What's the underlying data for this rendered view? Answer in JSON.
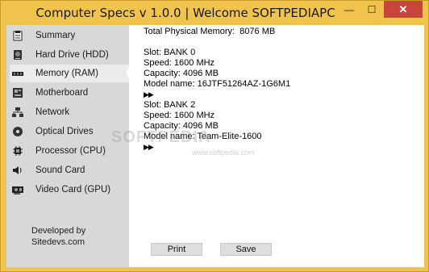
{
  "window": {
    "title": "Computer Specs v 1.0.0  |  Welcome SOFTPEDIAPC",
    "minimize_symbol": "—",
    "maximize_symbol": "☐",
    "close_symbol": "✕"
  },
  "sidebar": {
    "items": [
      {
        "label": "Summary",
        "icon": "clipboard-icon"
      },
      {
        "label": "Hard Drive (HDD)",
        "icon": "hard-drive-icon"
      },
      {
        "label": "Memory (RAM)",
        "icon": "memory-icon",
        "active": true
      },
      {
        "label": "Motherboard",
        "icon": "motherboard-icon"
      },
      {
        "label": "Network",
        "icon": "network-icon"
      },
      {
        "label": "Optical Drives",
        "icon": "disc-icon"
      },
      {
        "label": "Processor (CPU)",
        "icon": "processor-icon"
      },
      {
        "label": "Sound Card",
        "icon": "speaker-icon"
      },
      {
        "label": "Video Card (GPU)",
        "icon": "video-card-icon"
      }
    ],
    "developer_line1": "Developed by",
    "developer_line2": "Sitedevs.com"
  },
  "content": {
    "total_memory": "Total Physical Memory:  8076 MB",
    "marker": "▶▶",
    "slots": [
      {
        "slot": "Slot: BANK 0",
        "speed": "Speed: 1600 MHz",
        "capacity": "Capacity: 4096 MB",
        "model": "Model name: 16JTF51264AZ-1G6M1"
      },
      {
        "slot": "Slot: BANK 2",
        "speed": "Speed: 1600 MHz",
        "capacity": "Capacity: 4096 MB",
        "model": "Model name: Team-Elite-1600"
      }
    ]
  },
  "watermark": {
    "text": "SOFTPEDIA",
    "sub": "www.softpedia.com"
  },
  "buttons": {
    "print": "Print",
    "save": "Save"
  },
  "colors": {
    "titlebar": "#f0c44c",
    "close": "#c7453a",
    "sidebar": "#d8d8d8"
  }
}
